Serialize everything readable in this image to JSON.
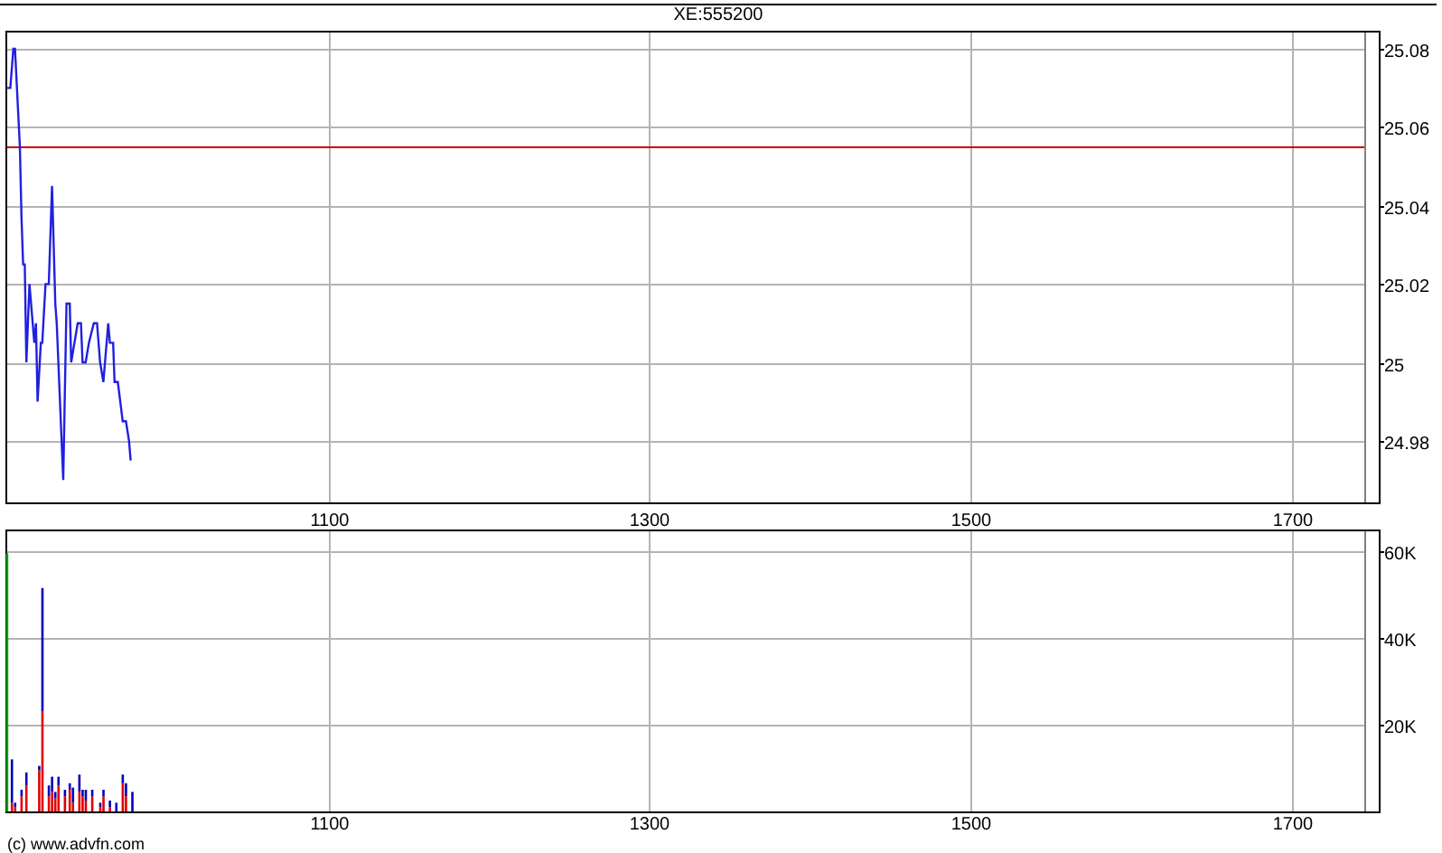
{
  "title": "XE:555200",
  "price_chart": {
    "chart_data": {
      "type": "line",
      "grid": true,
      "x": [
        900,
        902,
        904,
        905,
        908,
        909,
        910,
        911,
        912,
        914,
        917,
        918,
        919,
        921,
        922,
        924,
        926,
        928,
        930,
        931,
        935,
        937,
        939,
        940,
        942,
        944,
        946,
        947,
        949,
        951,
        954,
        956,
        958,
        960,
        963,
        964,
        966,
        967,
        969,
        972,
        974,
        976,
        977
      ],
      "series": [
        {
          "color": "#2020e0",
          "values": [
            25.07,
            25.07,
            25.08,
            25.08,
            25.055,
            25.037,
            25.025,
            25.025,
            25.0,
            25.02,
            25.005,
            25.01,
            24.99,
            25.005,
            25.005,
            25.02,
            25.02,
            25.045,
            25.015,
            25.01,
            24.97,
            25.015,
            25.015,
            25.0,
            25.005,
            25.01,
            25.01,
            25.0,
            25.0,
            25.005,
            25.01,
            25.01,
            25.0,
            24.995,
            25.01,
            25.005,
            25.005,
            24.995,
            24.995,
            24.985,
            24.985,
            24.98,
            24.975
          ]
        }
      ],
      "xlim": [
        899,
        1745
      ],
      "ylim": [
        24.9643,
        25.0846
      ],
      "xticks": [
        1100,
        1300,
        1500,
        1700
      ],
      "yticks": [
        {
          "value": 24.98,
          "label": "24.98"
        },
        {
          "value": 25,
          "label": "25"
        },
        {
          "value": 25.02,
          "label": "25.02"
        },
        {
          "value": 25.04,
          "label": "25.04"
        },
        {
          "value": 25.06,
          "label": "25.06"
        },
        {
          "value": 25.08,
          "label": "25.08"
        }
      ],
      "ref_lines": [
        {
          "axis": "y",
          "value": 25.055,
          "color": "#cc0000"
        }
      ]
    }
  },
  "volume_chart": {
    "chart_data": {
      "type": "bar",
      "stacked": true,
      "grid": true,
      "x": [
        900,
        903,
        905,
        909,
        912,
        920,
        922,
        926,
        928,
        930,
        932,
        936,
        939,
        941,
        945,
        947,
        949,
        953,
        958,
        960,
        964,
        968,
        972,
        974,
        978
      ],
      "series": [
        {
          "color": "#00a000",
          "values": [
            59500,
            null,
            null,
            null,
            null,
            null,
            null,
            null,
            null,
            null,
            null,
            null,
            null,
            null,
            null,
            null,
            null,
            null,
            null,
            null,
            null,
            null,
            null,
            null,
            null
          ]
        },
        {
          "color": "#e00000",
          "values": [
            null,
            2000,
            1000,
            3500,
            6000,
            9500,
            23000,
            3500,
            4500,
            3000,
            6000,
            3500,
            5000,
            2000,
            4500,
            3500,
            2500,
            3500,
            1000,
            3500,
            1000,
            null,
            6500,
            3500,
            null
          ]
        },
        {
          "color": "#0000c0",
          "values": [
            null,
            10000,
            1000,
            1500,
            3000,
            1000,
            28500,
            2500,
            3500,
            1500,
            2000,
            1500,
            1500,
            3500,
            4000,
            1500,
            2500,
            1500,
            1000,
            1500,
            1500,
            2000,
            2000,
            3000,
            4500
          ]
        }
      ],
      "xlim": [
        899,
        1745
      ],
      "ylim": [
        0,
        65000
      ],
      "xticks": [
        1100,
        1300,
        1500,
        1700
      ],
      "yticks": [
        {
          "value": 20000,
          "label": "20K"
        },
        {
          "value": 40000,
          "label": "40K"
        },
        {
          "value": 60000,
          "label": "60K"
        }
      ]
    }
  },
  "credit": "(c) www.advfn.com"
}
